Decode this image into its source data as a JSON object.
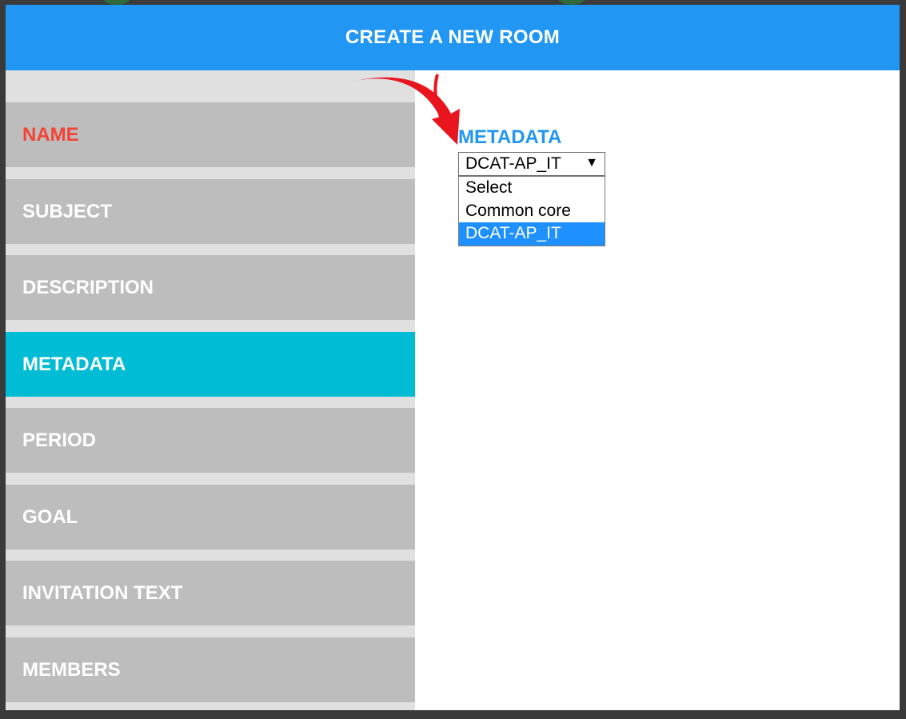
{
  "modal": {
    "title": "CREATE A NEW ROOM"
  },
  "sidebar": {
    "items": [
      {
        "label": "NAME",
        "state": "error"
      },
      {
        "label": "SUBJECT",
        "state": "normal"
      },
      {
        "label": "DESCRIPTION",
        "state": "normal"
      },
      {
        "label": "METADATA",
        "state": "active"
      },
      {
        "label": "PERIOD",
        "state": "normal"
      },
      {
        "label": "GOAL",
        "state": "normal"
      },
      {
        "label": "INVITATION TEXT",
        "state": "normal"
      },
      {
        "label": "MEMBERS",
        "state": "normal"
      }
    ]
  },
  "content": {
    "field_title": "METADATA",
    "select": {
      "value": "DCAT-AP_IT",
      "arrow": "▼",
      "options": [
        "Select",
        "Common core",
        "DCAT-AP_IT"
      ],
      "selected_index": 2
    }
  },
  "colors": {
    "header": "#2196f3",
    "sidebar_item": "#bdbdbd",
    "sidebar_active": "#00bcd4",
    "error_text": "#f44336",
    "field_title": "#2196f3",
    "annotation_arrow": "#e8141e"
  },
  "icons": {
    "annotation": "red-curved-arrow-icon",
    "dropdown": "triangle-down-icon"
  }
}
